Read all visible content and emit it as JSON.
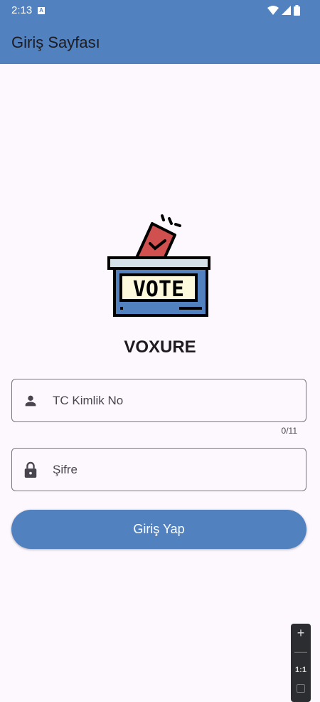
{
  "status_bar": {
    "time": "2:13",
    "notification_icon": "A"
  },
  "app_bar": {
    "title": "Giriş Sayfası"
  },
  "logo": {
    "text": "VOTE"
  },
  "brand": "VOXURE",
  "tc_field": {
    "placeholder": "TC Kimlik No",
    "value": "",
    "counter": "0/11"
  },
  "password_field": {
    "placeholder": "Şifre",
    "value": ""
  },
  "login_button": "Giriş Yap",
  "zoom_controls": {
    "zoom_in": "+",
    "zoom_out": "—",
    "reset": "1:1"
  },
  "colors": {
    "primary": "#5181be",
    "background": "#fdf7fe",
    "ballot": "#d04f4f"
  }
}
